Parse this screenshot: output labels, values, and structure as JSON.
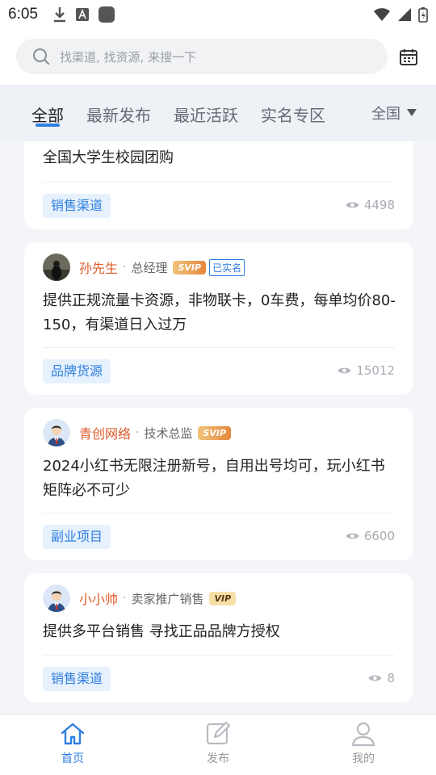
{
  "status_bar": {
    "time": "6:05"
  },
  "search": {
    "placeholder": "找渠道, 找资源, 来搜一下"
  },
  "tabs": [
    {
      "label": "全部",
      "active": true
    },
    {
      "label": "最新发布"
    },
    {
      "label": "最近活跃"
    },
    {
      "label": "实名专区"
    }
  ],
  "region": {
    "label": "全国"
  },
  "posts": [
    {
      "title": "全国大学生校园团购",
      "tag": "销售渠道",
      "views": "4498"
    },
    {
      "name": "孙先生",
      "role": "总经理",
      "badge": "SVIP",
      "verified": "已实名",
      "title": "提供正规流量卡资源，非物联卡，0车费，每单均价80-150，有渠道日入过万",
      "tag": "品牌货源",
      "views": "15012"
    },
    {
      "name": "青创网络",
      "role": "技术总监",
      "badge": "SVIP",
      "title": "2024小红书无限注册新号，自用出号均可，玩小红书矩阵必不可少",
      "tag": "副业项目",
      "views": "6600"
    },
    {
      "name": "小小帅",
      "role": "卖家推广销售",
      "badge": "VIP",
      "title": "提供多平台销售 寻找正品品牌方授权",
      "tag": "销售渠道",
      "views": "8"
    }
  ],
  "bottom_nav": [
    {
      "label": "首页",
      "icon": "home-icon",
      "active": true
    },
    {
      "label": "发布",
      "icon": "edit-icon"
    },
    {
      "label": "我的",
      "icon": "user-icon"
    }
  ],
  "colors": {
    "accent": "#2f7fe0",
    "name": "#e05a2a",
    "tag_bg": "#e6f1fd"
  }
}
